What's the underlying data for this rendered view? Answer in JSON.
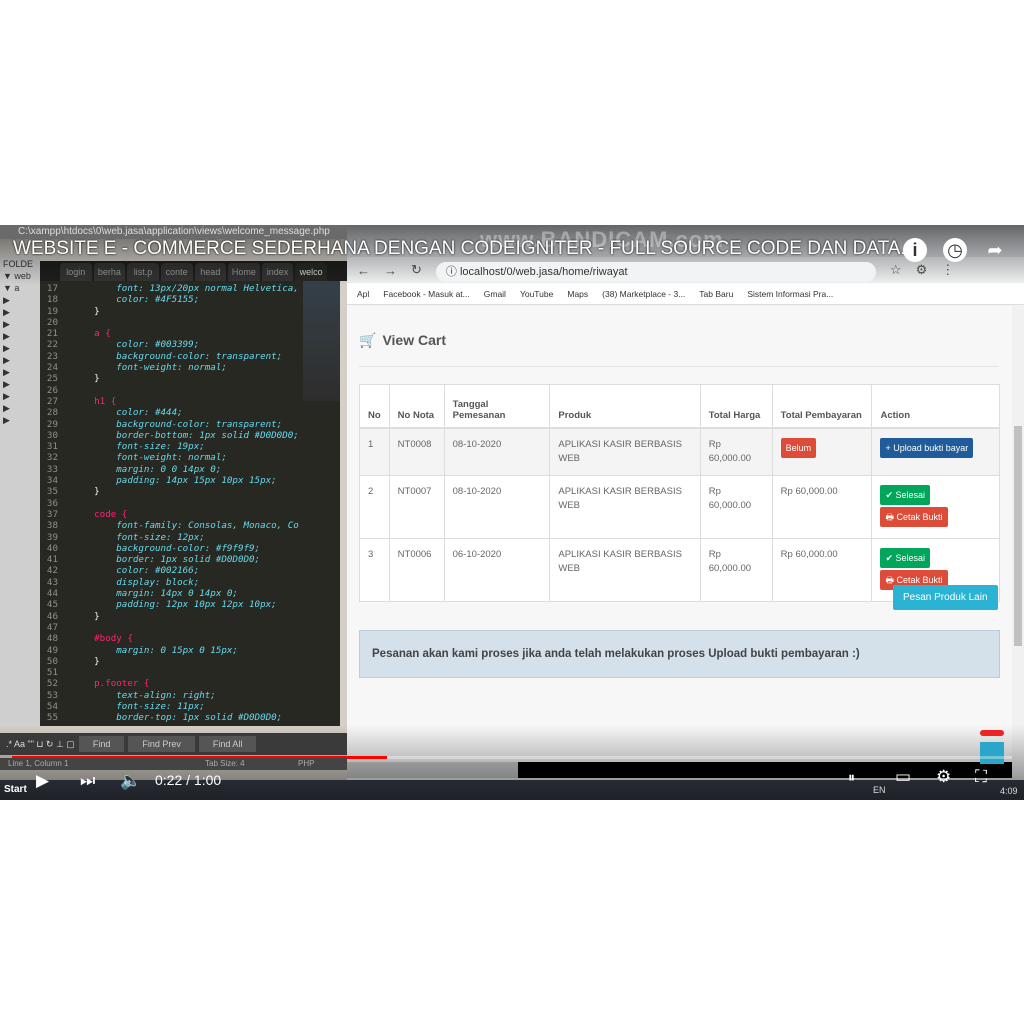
{
  "video": {
    "title": "WEBSITE E - COMMERCE SEDERHANA DENGAN CODEIGNITER - FULL SOURCE CODE DAN DATA...",
    "watermark": "www.BANDICAM.com",
    "time": "0:22 / 1:00",
    "progress_percent": 37.5
  },
  "editor": {
    "title": "C:\\xampp\\htdocs\\0\\web.jasa\\application\\views\\welcome_message.php",
    "sidebar": [
      "FOLDE",
      "▼ web",
      "▼ a",
      "▶",
      "▶",
      "▶",
      "▶",
      "▶",
      "▶",
      "▶",
      "▶",
      "▶",
      "▶",
      "▶"
    ],
    "tabs": [
      "login",
      "berha",
      "list.p",
      "conte",
      "head",
      "Home",
      "index",
      "welco"
    ],
    "lines": [
      {
        "n": "17",
        "t": "\t\tfont: 13px/20px normal Helvetica,"
      },
      {
        "n": "18",
        "t": "\t\tcolor: #4F5155;"
      },
      {
        "n": "19",
        "t": "\t}"
      },
      {
        "n": "20",
        "t": ""
      },
      {
        "n": "21",
        "t": "\ta {"
      },
      {
        "n": "22",
        "t": "\t\tcolor: #003399;"
      },
      {
        "n": "23",
        "t": "\t\tbackground-color: transparent;"
      },
      {
        "n": "24",
        "t": "\t\tfont-weight: normal;"
      },
      {
        "n": "25",
        "t": "\t}"
      },
      {
        "n": "26",
        "t": ""
      },
      {
        "n": "27",
        "t": "\th1 {"
      },
      {
        "n": "28",
        "t": "\t\tcolor: #444;"
      },
      {
        "n": "29",
        "t": "\t\tbackground-color: transparent;"
      },
      {
        "n": "30",
        "t": "\t\tborder-bottom: 1px solid #D0D0D0;"
      },
      {
        "n": "31",
        "t": "\t\tfont-size: 19px;"
      },
      {
        "n": "32",
        "t": "\t\tfont-weight: normal;"
      },
      {
        "n": "33",
        "t": "\t\tmargin: 0 0 14px 0;"
      },
      {
        "n": "34",
        "t": "\t\tpadding: 14px 15px 10px 15px;"
      },
      {
        "n": "35",
        "t": "\t}"
      },
      {
        "n": "36",
        "t": ""
      },
      {
        "n": "37",
        "t": "\tcode {"
      },
      {
        "n": "38",
        "t": "\t\tfont-family: Consolas, Monaco, Co"
      },
      {
        "n": "39",
        "t": "\t\tfont-size: 12px;"
      },
      {
        "n": "40",
        "t": "\t\tbackground-color: #f9f9f9;"
      },
      {
        "n": "41",
        "t": "\t\tborder: 1px solid #D0D0D0;"
      },
      {
        "n": "42",
        "t": "\t\tcolor: #002166;"
      },
      {
        "n": "43",
        "t": "\t\tdisplay: block;"
      },
      {
        "n": "44",
        "t": "\t\tmargin: 14px 0 14px 0;"
      },
      {
        "n": "45",
        "t": "\t\tpadding: 12px 10px 12px 10px;"
      },
      {
        "n": "46",
        "t": "\t}"
      },
      {
        "n": "47",
        "t": ""
      },
      {
        "n": "48",
        "t": "\t#body {"
      },
      {
        "n": "49",
        "t": "\t\tmargin: 0 15px 0 15px;"
      },
      {
        "n": "50",
        "t": "\t}"
      },
      {
        "n": "51",
        "t": ""
      },
      {
        "n": "52",
        "t": "\tp.footer {"
      },
      {
        "n": "53",
        "t": "\t\ttext-align: right;"
      },
      {
        "n": "54",
        "t": "\t\tfont-size: 11px;"
      },
      {
        "n": "55",
        "t": "\t\tborder-top: 1px solid #D0D0D0;"
      }
    ],
    "find_tools": ".* Aa \"\" ⊔ ↻ ⊥ ▢",
    "find": "Find",
    "find_prev": "Find Prev",
    "find_all": "Find All",
    "status": {
      "position": "Line 1, Column 1",
      "tab_size": "Tab Size: 4",
      "syntax": "PHP"
    }
  },
  "browser": {
    "url": "localhost/0/web.jasa/home/riwayat",
    "bookmarks": [
      "Apl",
      "Facebook - Masuk at...",
      "Gmail",
      "YouTube",
      "Maps",
      "(38) Marketplace - 3...",
      "Tab Baru",
      "Sistem Informasi Pra..."
    ]
  },
  "page": {
    "heading": "View Cart",
    "headers": [
      "No",
      "No Nota",
      "Tanggal Pemesanan",
      "Produk",
      "Total Harga",
      "Total Pembayaran",
      "Action"
    ],
    "rows": [
      {
        "no": "1",
        "nota": "NT0008",
        "tanggal": "08-10-2020",
        "produk": "APLIKASI KASIR BERBASIS WEB",
        "harga": "Rp 60,000.00",
        "bayar": "Belum",
        "action": "+ Upload bukti bayar"
      },
      {
        "no": "2",
        "nota": "NT0007",
        "tanggal": "08-10-2020",
        "produk": "APLIKASI KASIR BERBASIS WEB",
        "harga": "Rp 60,000.00",
        "bayar": "Rp 60,000.00",
        "action": "✔ Selesai",
        "action2": "🖶 Cetak Bukti"
      },
      {
        "no": "3",
        "nota": "NT0006",
        "tanggal": "06-10-2020",
        "produk": "APLIKASI KASIR BERBASIS WEB",
        "harga": "Rp 60,000.00",
        "bayar": "Rp 60,000.00",
        "action": "✔ Selesai",
        "action2": "🖶 Cetak Bukti"
      }
    ],
    "order_more": "Pesan Produk Lain",
    "notice": "Pesanan akan kami proses jika anda telah melakukan proses Upload bukti pembayaran :)"
  },
  "taskbar": {
    "start": "Start",
    "lang": "EN",
    "clock": "4:09"
  }
}
